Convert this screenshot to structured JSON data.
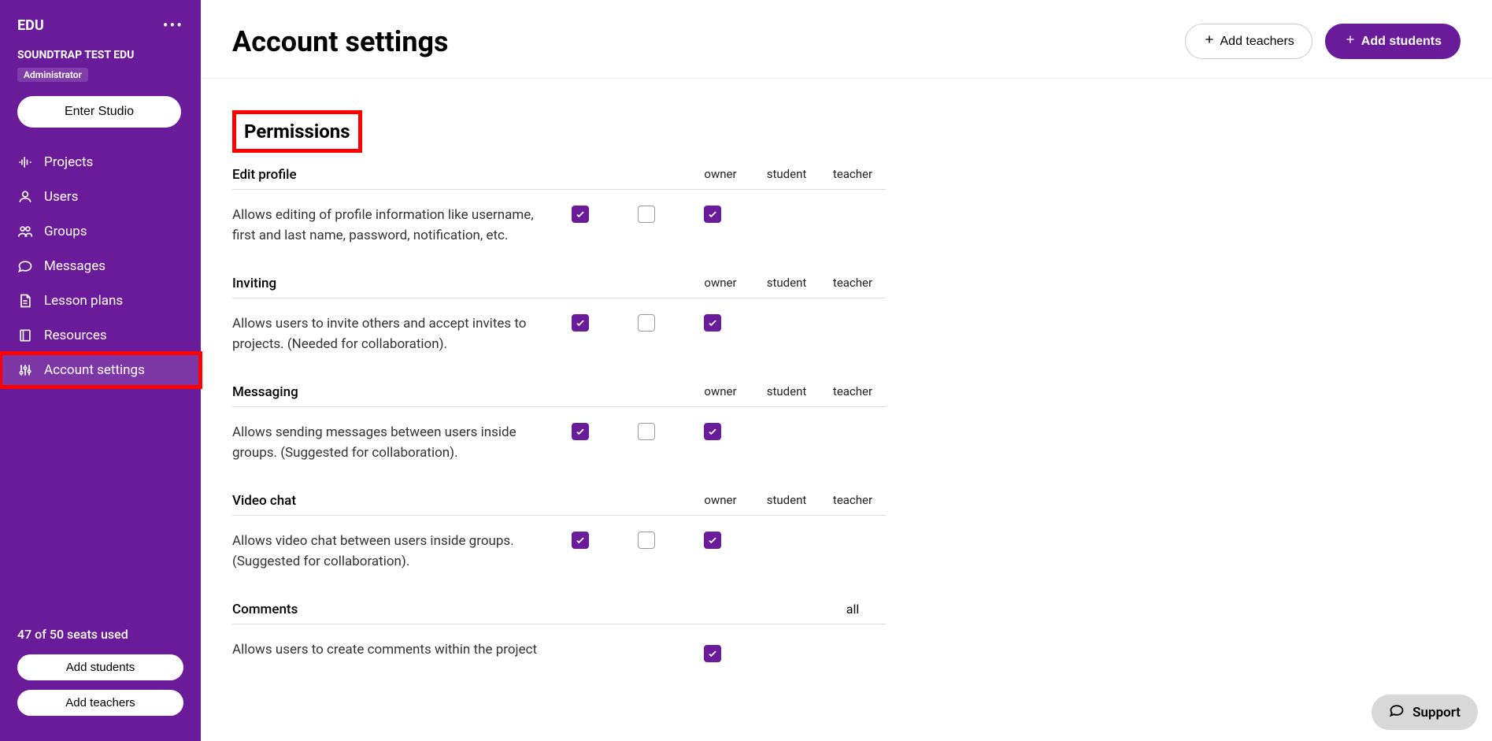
{
  "sidebar": {
    "edu_label": "EDU",
    "org_name": "SOUNDTRAP TEST EDU",
    "role": "Administrator",
    "enter_studio": "Enter Studio",
    "nav": [
      {
        "label": "Projects",
        "icon": "waveform"
      },
      {
        "label": "Users",
        "icon": "user"
      },
      {
        "label": "Groups",
        "icon": "users"
      },
      {
        "label": "Messages",
        "icon": "chat"
      },
      {
        "label": "Lesson plans",
        "icon": "document"
      },
      {
        "label": "Resources",
        "icon": "book"
      },
      {
        "label": "Account settings",
        "icon": "sliders"
      }
    ],
    "seats": "47 of 50 seats used",
    "add_students": "Add students",
    "add_teachers": "Add teachers"
  },
  "header": {
    "title": "Account settings",
    "add_teachers": "Add teachers",
    "add_students": "Add students"
  },
  "permissions": {
    "title": "Permissions",
    "cols": {
      "owner": "owner",
      "student": "student",
      "teacher": "teacher",
      "all": "all"
    },
    "rows": [
      {
        "name": "Edit profile",
        "desc": "Allows editing of profile information like username, first and last name, password, notification, etc.",
        "owner": true,
        "student": false,
        "teacher": true
      },
      {
        "name": "Inviting",
        "desc": "Allows users to invite others and accept invites to projects. (Needed for collaboration).",
        "owner": true,
        "student": false,
        "teacher": true
      },
      {
        "name": "Messaging",
        "desc": "Allows sending messages between users inside groups. (Suggested for collaboration).",
        "owner": true,
        "student": false,
        "teacher": true
      },
      {
        "name": "Video chat",
        "desc": "Allows video chat between users inside groups. (Suggested for collaboration).",
        "owner": true,
        "student": false,
        "teacher": true
      }
    ],
    "comments": {
      "name": "Comments",
      "desc_partial": "Allows users to create comments within the project"
    }
  },
  "support": "Support"
}
